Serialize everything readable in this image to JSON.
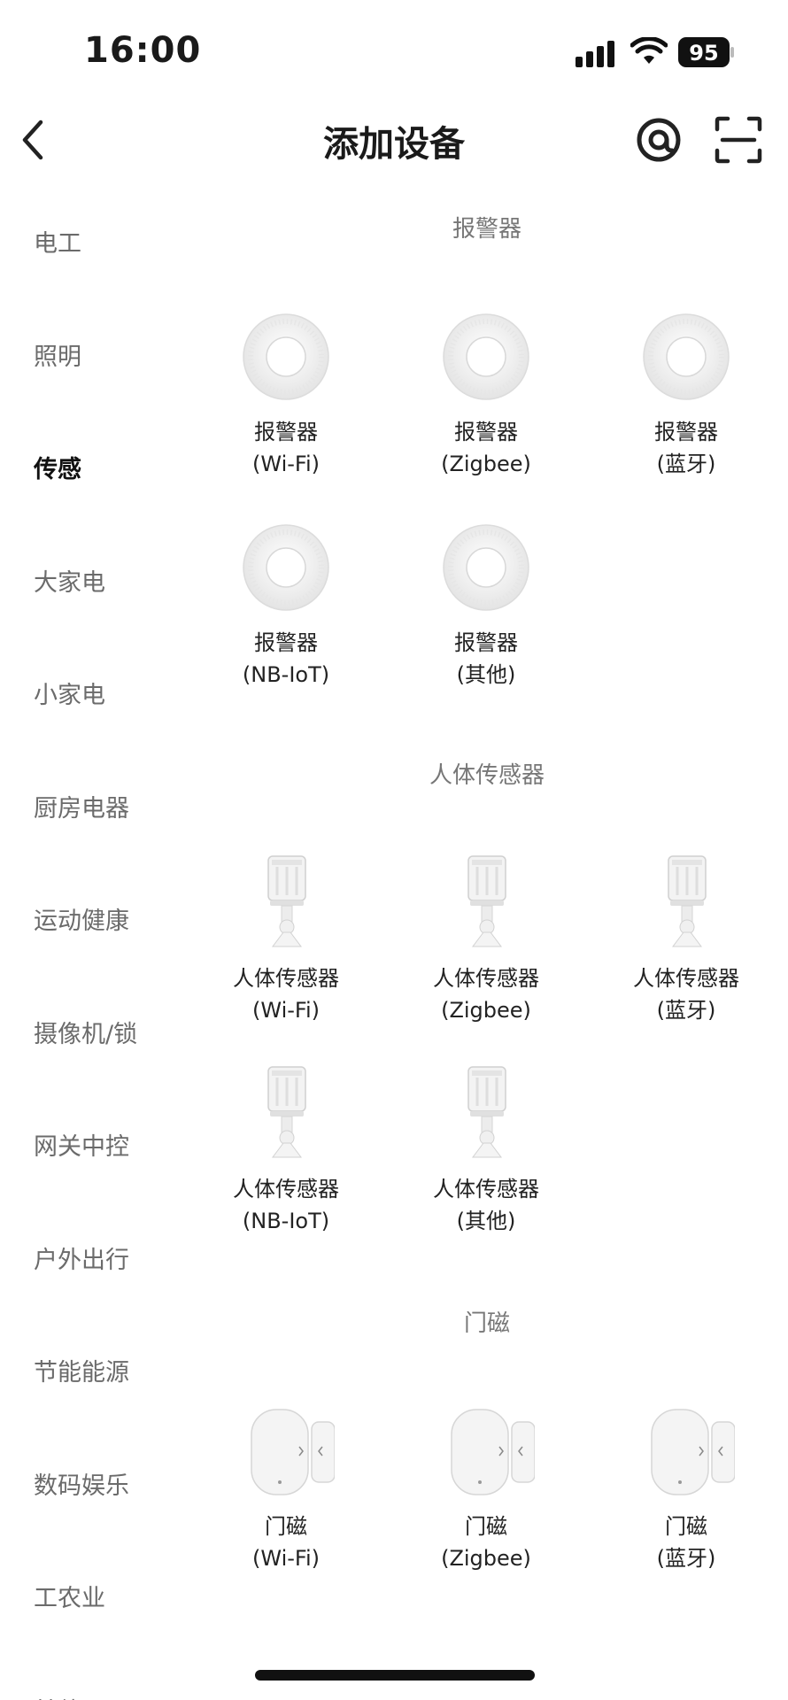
{
  "status_bar": {
    "time": "16:00",
    "battery": "95"
  },
  "header": {
    "title": "添加设备"
  },
  "sidebar": {
    "items": [
      {
        "label": "电工"
      },
      {
        "label": "照明"
      },
      {
        "label": "传感",
        "active": true
      },
      {
        "label": "大家电"
      },
      {
        "label": "小家电"
      },
      {
        "label": "厨房电器"
      },
      {
        "label": "运动健康"
      },
      {
        "label": "摄像机/锁"
      },
      {
        "label": "网关中控"
      },
      {
        "label": "户外出行"
      },
      {
        "label": "节能能源"
      },
      {
        "label": "数码娱乐"
      },
      {
        "label": "工农业"
      },
      {
        "label": "其他"
      }
    ]
  },
  "sections": [
    {
      "title": "报警器",
      "icon": "alarm-device-icon",
      "items": [
        {
          "name": "报警器",
          "variant": "(Wi-Fi)"
        },
        {
          "name": "报警器",
          "variant": "(Zigbee)"
        },
        {
          "name": "报警器",
          "variant": "(蓝牙)"
        },
        {
          "name": "报警器",
          "variant": "(NB-IoT)"
        },
        {
          "name": "报警器",
          "variant": "(其他)"
        }
      ]
    },
    {
      "title": "人体传感器",
      "icon": "motion-sensor-icon",
      "items": [
        {
          "name": "人体传感器",
          "variant": "(Wi-Fi)"
        },
        {
          "name": "人体传感器",
          "variant": "(Zigbee)"
        },
        {
          "name": "人体传感器",
          "variant": "(蓝牙)"
        },
        {
          "name": "人体传感器",
          "variant": "(NB-IoT)"
        },
        {
          "name": "人体传感器",
          "variant": "(其他)"
        }
      ]
    },
    {
      "title": "门磁",
      "icon": "door-sensor-icon",
      "items": [
        {
          "name": "门磁",
          "variant": "(Wi-Fi)"
        },
        {
          "name": "门磁",
          "variant": "(Zigbee)"
        },
        {
          "name": "门磁",
          "variant": "(蓝牙)"
        }
      ]
    }
  ]
}
